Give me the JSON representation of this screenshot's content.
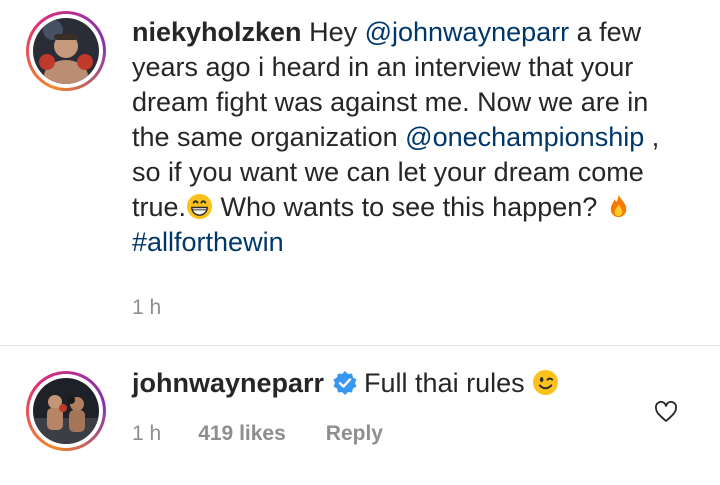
{
  "comments": [
    {
      "username": "niekyholzken",
      "text_parts": {
        "p1": " Hey ",
        "mention1": "@johnwayneparr",
        "p2": " a few years ago i heard in an interview that your dream fight was against me. Now we are in the same organization ",
        "mention2": "@onechampionship",
        "p3": " , so if you want we can let your dream come true.",
        "p4": " Who wants to see this happen? ",
        "hashtag": "#allforthewin"
      },
      "emojis": [
        "grinning-face",
        "fire"
      ],
      "time": "1 h"
    },
    {
      "username": "johnwayneparr",
      "verified": true,
      "text": "Full thai rules",
      "emoji": "winking-face",
      "time": "1 h",
      "likes": "419 likes",
      "reply_label": "Reply"
    }
  ],
  "colors": {
    "text": "#262626",
    "link": "#00376b",
    "meta": "#8e8e8e",
    "verified": "#3897f0",
    "divider": "#e6e6e6"
  }
}
